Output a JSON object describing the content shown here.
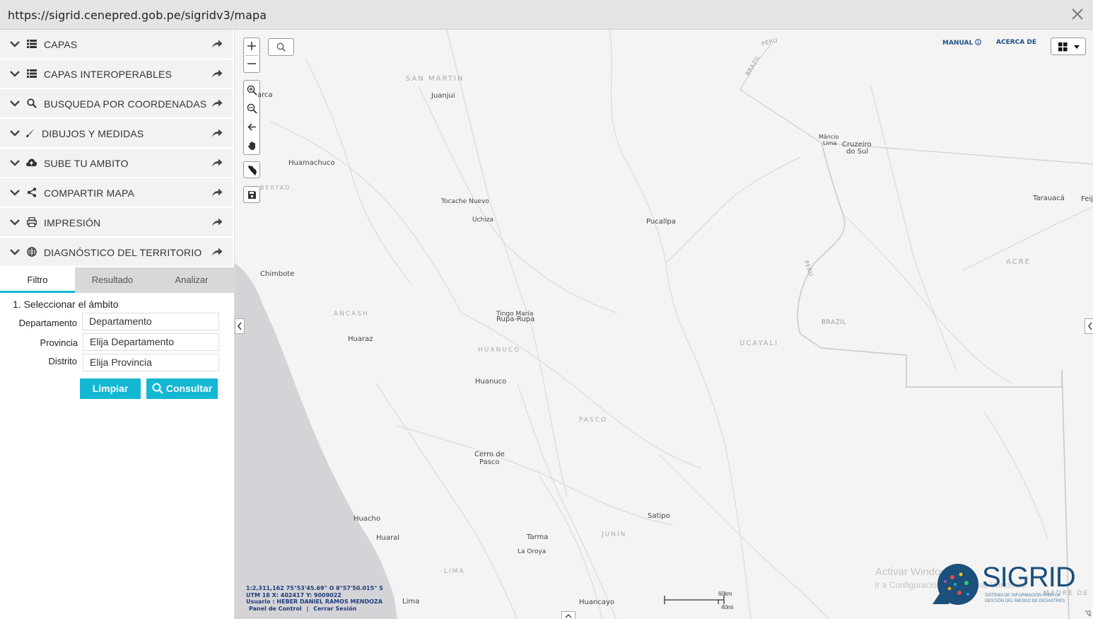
{
  "browser": {
    "url": "https://sigrid.cenepred.gob.pe/sigridv3/mapa"
  },
  "sidebar": {
    "items": [
      {
        "label": "CAPAS",
        "icon": "list-icon"
      },
      {
        "label": "CAPAS INTEROPERABLES",
        "icon": "list-icon"
      },
      {
        "label": "BUSQUEDA POR COORDENADAS",
        "icon": "search-icon"
      },
      {
        "label": "DIBUJOS Y MEDIDAS",
        "icon": "brush-icon"
      },
      {
        "label": "SUBE TU AMBITO",
        "icon": "cloud-upload-icon"
      },
      {
        "label": "COMPARTIR MAPA",
        "icon": "share-icon"
      },
      {
        "label": "IMPRESIÓN",
        "icon": "print-icon"
      },
      {
        "label": "DIAGNÓSTICO DEL TERRITORIO",
        "icon": "globe-icon"
      }
    ],
    "tabs": [
      "Filtro",
      "Resultado",
      "Analizar"
    ],
    "active_tab": "Filtro",
    "form": {
      "section_title": "1. Seleccionar el ámbito",
      "departamento_label": "Departamento",
      "departamento_value": "Departamento",
      "provincia_label": "Provincia",
      "provincia_value": "Elija Departamento",
      "distrito_label": "Distrito",
      "distrito_value": "Elija Provincia",
      "limpiar_label": "Limpiar",
      "consultar_label": "Consultar"
    }
  },
  "map": {
    "top_links": {
      "manual": "MANUAL",
      "acerca": "ACERCA DE"
    },
    "places": [
      "Juanjui",
      "Huamachuco",
      "Tocache Nuevo",
      "Uchiza",
      "Pucallpa",
      "Chimbote",
      "Tingo María",
      "Rupa-Rupa",
      "Huaraz",
      "Huanuco",
      "Cerro de",
      "Pasco",
      "Huacho",
      "Huaral",
      "Tarma",
      "La Oroya",
      "Satipo",
      "Lima",
      "Huancayo",
      "Mâncio",
      "Lima",
      "Cruzeiro",
      "do Sul",
      "Tarauacá",
      "Feij",
      "arca"
    ],
    "regions": [
      "SAN MARTIN",
      "ANCASH",
      "HUANUCO",
      "PASCO",
      "UCAYALI",
      "JUNÍN",
      "LIMA",
      "ACRE",
      "BRAZIL",
      "PERU",
      "BRAZIL",
      "PERU",
      "BERTAD",
      "MADRE DE D"
    ],
    "status": {
      "line1": "1:2,311,162     75°53'45.69\" O   8°57'50.015\" S",
      "line2": "UTM 18 X: 402417   Y: 9009022",
      "line3": "Usuario : HEBER DANIEL RAMOS MENDOZA",
      "panel": "Panel de Control",
      "sep": "|",
      "logout": "Cerrar Sesión"
    },
    "scale": {
      "km": "60km",
      "mi": "40mi"
    },
    "watermark": {
      "title": "Activar Windows",
      "sub": "Ir a Configuración para activar Windows."
    },
    "logo": {
      "name": "SIGRID",
      "line1": "SISTEMA DE INFORMACIÓN PARA LA",
      "line2": "GESTIÓN DEL RIESGO DE DESASTRES"
    }
  },
  "colors": {
    "accent": "#14b7d2",
    "link": "#1f4e88",
    "sea": "#d4d4d8",
    "land": "#f4f4f4"
  }
}
